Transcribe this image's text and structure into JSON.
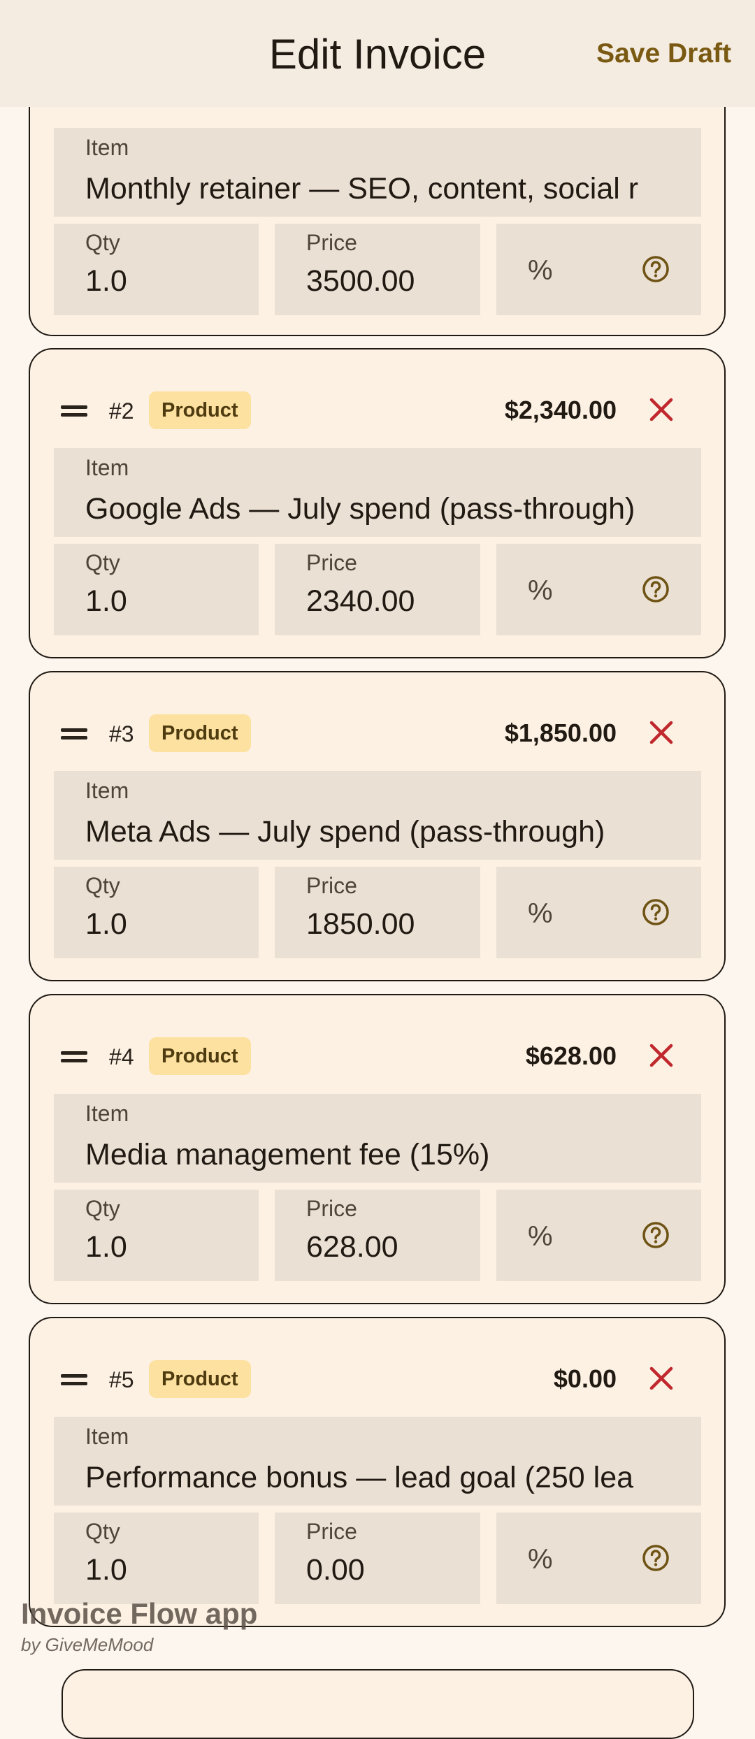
{
  "appbar": {
    "title": "Edit Invoice",
    "save_label": "Save Draft"
  },
  "field_labels": {
    "item": "Item",
    "qty": "Qty",
    "price": "Price",
    "percent": "%"
  },
  "items": [
    {
      "number": "",
      "badge": "",
      "amount": "",
      "description": "Monthly retainer — SEO, content, social r",
      "qty": "1.0",
      "price": "3500.00"
    },
    {
      "number": "#2",
      "badge": "Product",
      "amount": "$2,340.00",
      "description": "Google Ads — July spend (pass-through)",
      "qty": "1.0",
      "price": "2340.00"
    },
    {
      "number": "#3",
      "badge": "Product",
      "amount": "$1,850.00",
      "description": "Meta Ads — July spend (pass-through)",
      "qty": "1.0",
      "price": "1850.00"
    },
    {
      "number": "#4",
      "badge": "Product",
      "amount": "$628.00",
      "description": "Media management fee (15%)",
      "qty": "1.0",
      "price": "628.00"
    },
    {
      "number": "#5",
      "badge": "Product",
      "amount": "$0.00",
      "description": "Performance bonus — lead goal (250 lea",
      "qty": "1.0",
      "price": "0.00"
    }
  ],
  "watermark": {
    "title": "Invoice Flow app",
    "subtitle": "by GiveMeMood"
  },
  "colors": {
    "accent": "#7a5a12",
    "badge_bg": "#fde1a0",
    "delete": "#c0282d",
    "card_bg": "#fdf1e4",
    "field_bg": "#ebe0d4"
  },
  "icons": {
    "drag": "drag-handle-icon",
    "delete": "close-icon",
    "help": "help-circle-icon"
  }
}
